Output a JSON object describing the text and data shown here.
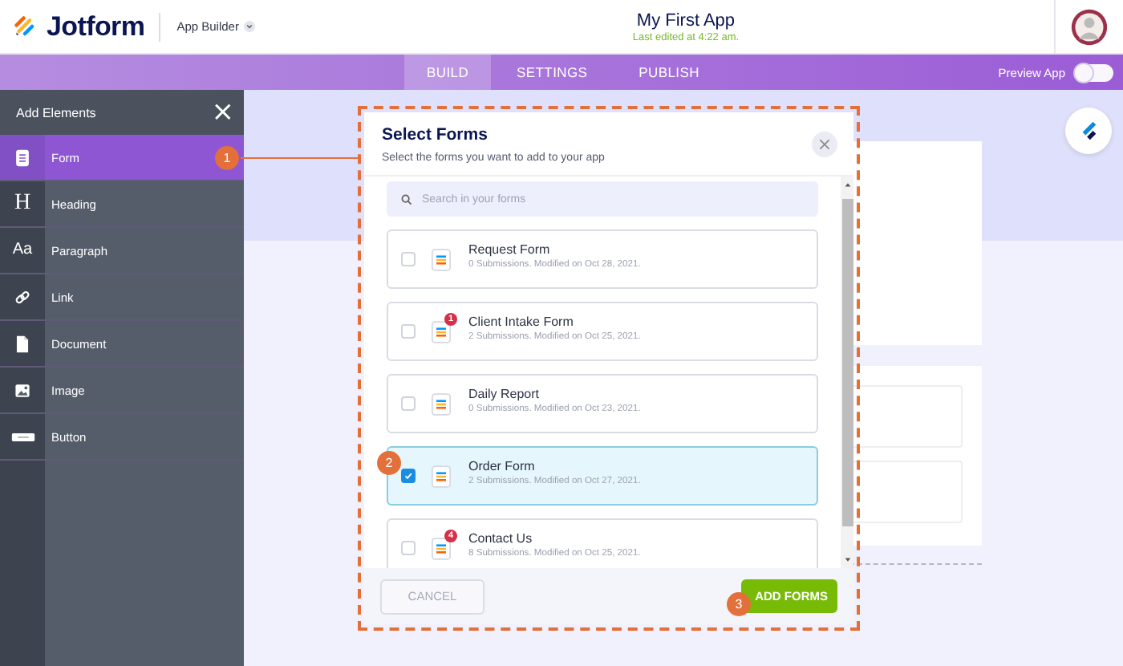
{
  "header": {
    "brand": "Jotform",
    "product": "App Builder",
    "app_title": "My First App",
    "last_edited": "Last edited at 4:22 am."
  },
  "nav": {
    "tabs": [
      {
        "label": "BUILD",
        "selected": true
      },
      {
        "label": "SETTINGS",
        "selected": false
      },
      {
        "label": "PUBLISH",
        "selected": false
      }
    ],
    "preview": {
      "label": "Preview App",
      "on": false
    }
  },
  "sidebar": {
    "title": "Add Elements",
    "close": "×",
    "items": [
      {
        "label": "Form",
        "kind": "form",
        "selected": true
      },
      {
        "label": "Heading",
        "kind": "glyph",
        "glyph": "H",
        "selected": false
      },
      {
        "label": "Paragraph",
        "kind": "glyph",
        "glyph": "Aa",
        "selected": false
      },
      {
        "label": "Link",
        "kind": "link",
        "selected": false
      },
      {
        "label": "Document",
        "kind": "document",
        "selected": false
      },
      {
        "label": "Image",
        "kind": "image",
        "selected": false
      },
      {
        "label": "Button",
        "kind": "button",
        "selected": false
      }
    ]
  },
  "dialog": {
    "title": "Select Forms",
    "subtitle": "Select the forms you want to add to your app",
    "search": {
      "placeholder": "Search in your forms"
    },
    "forms": [
      {
        "name": "Request Form",
        "meta": "0 Submissions. Modified on Oct 28, 2021.",
        "checked": false
      },
      {
        "name": "Client Intake Form",
        "meta": "2 Submissions. Modified on Oct 25, 2021.",
        "checked": false,
        "badge": "1"
      },
      {
        "name": "Daily Report",
        "meta": "0 Submissions. Modified on Oct 23, 2021.",
        "checked": false
      },
      {
        "name": "Order Form",
        "meta": "2 Submissions. Modified on Oct 27, 2021.",
        "checked": true
      },
      {
        "name": "Contact Us",
        "meta": "8 Submissions. Modified on Oct 25, 2021.",
        "checked": false,
        "badge": "4"
      }
    ],
    "cancel": "CANCEL",
    "confirm": "ADD FORMS"
  },
  "callouts": [
    "1",
    "2",
    "3"
  ]
}
